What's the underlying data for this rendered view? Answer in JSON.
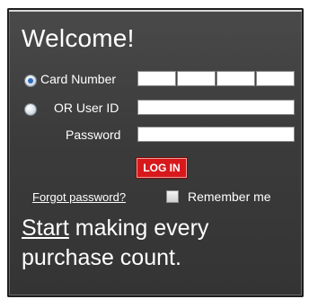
{
  "welcome": {
    "title": "Welcome!"
  },
  "login_form": {
    "card_number_label": "Card Number",
    "user_id_label": "OR User ID",
    "password_label": "Password",
    "selected_option": "card_number",
    "card_number_segments": [
      "",
      "",
      "",
      ""
    ],
    "user_id_value": "",
    "password_value": "",
    "login_button": "LOG IN"
  },
  "options": {
    "forgot_password": "Forgot password?",
    "remember_me": "Remember me",
    "remember_checked": false
  },
  "promo": {
    "start_link": "Start",
    "rest": " making every purchase count."
  }
}
